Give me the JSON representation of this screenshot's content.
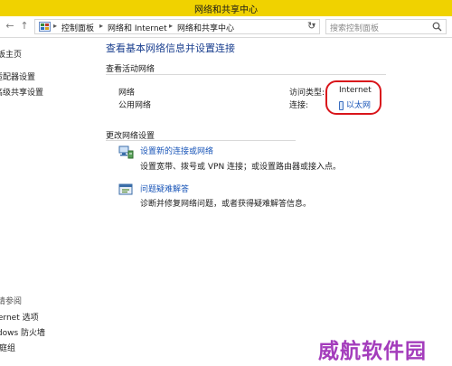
{
  "window": {
    "title": "网络和共享中心"
  },
  "navbar": {
    "back_icon": "back-arrow-icon",
    "up_icon": "up-arrow-icon",
    "breadcrumb": [
      "控制面板",
      "网络和 Internet",
      "网络和共享中心"
    ],
    "search_placeholder": "搜索控制面板"
  },
  "sidebar": {
    "items": [
      "面板主页",
      "适配器设置",
      "高级共享设置"
    ],
    "see_also_label": "另请参阅",
    "see_also": [
      "Internet 选项",
      "Windows 防火墙",
      "家庭组"
    ]
  },
  "main": {
    "heading": "查看基本网络信息并设置连接",
    "active_networks_label": "查看活动网络",
    "network": {
      "name": "网络",
      "type": "公用网络",
      "access_type_label": "访问类型:",
      "access_type_value": "Internet",
      "connections_label": "连接:",
      "connection_link": "以太网"
    },
    "change_settings_label": "更改网络设置",
    "tasks": [
      {
        "icon": "network-setup-icon",
        "link": "设置新的连接或网络",
        "desc": "设置宽带、拨号或 VPN 连接；或设置路由器或接入点。"
      },
      {
        "icon": "troubleshoot-icon",
        "link": "问题疑难解答",
        "desc": "诊断并修复网络问题，或者获得疑难解答信息。"
      }
    ]
  },
  "watermark": {
    "text": "威航软件园"
  },
  "colors": {
    "titlebar": "#f0d200",
    "link": "#1a56b8",
    "heading": "#1a3f8f",
    "highlight": "#d9151b",
    "watermark": "#a43dbc"
  }
}
